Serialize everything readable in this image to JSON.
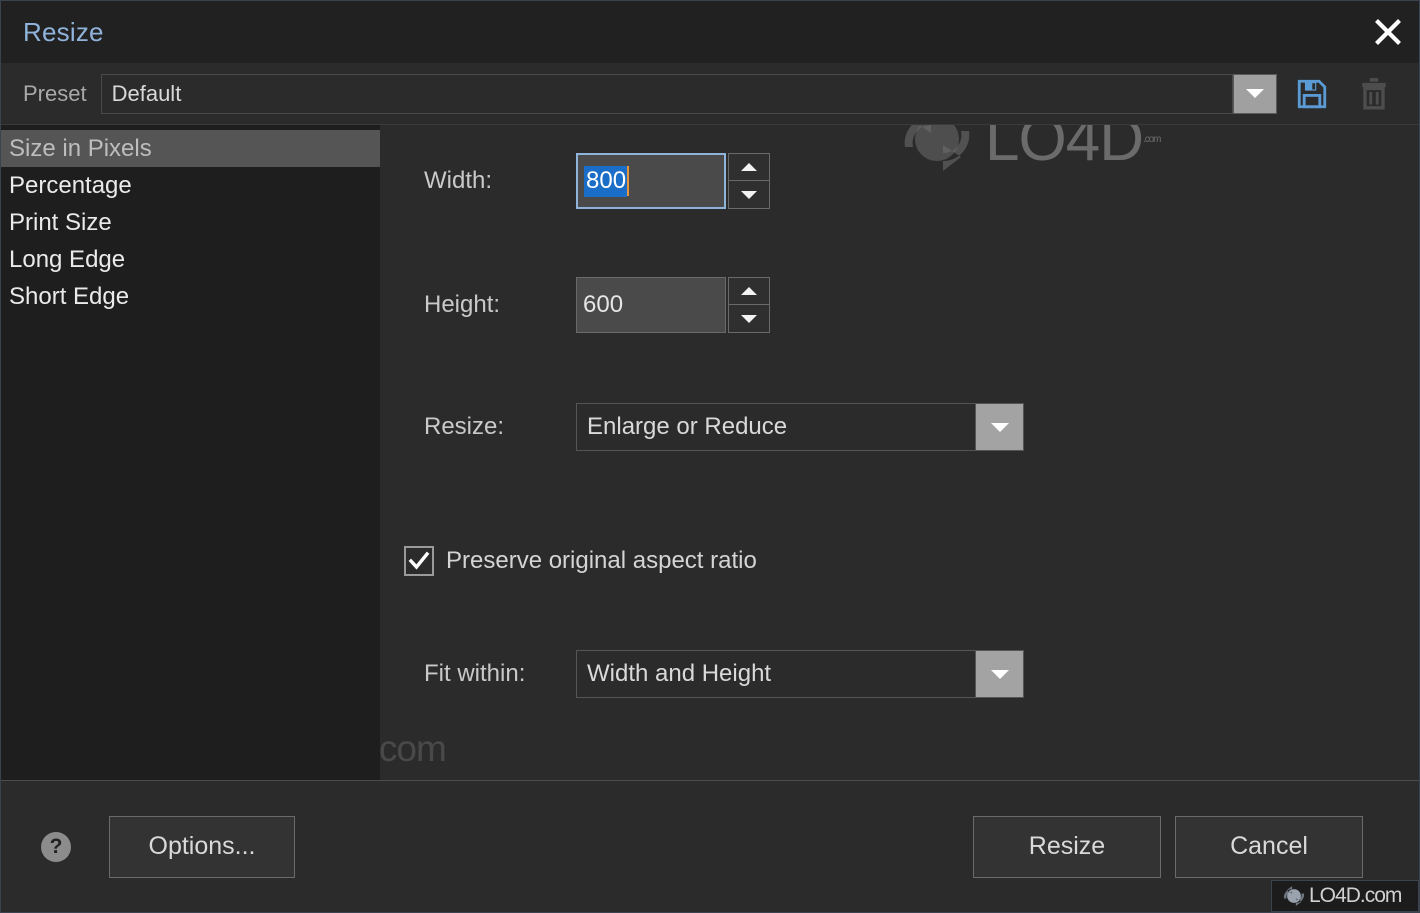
{
  "window": {
    "title": "Resize",
    "close_icon": "close-icon"
  },
  "preset": {
    "label": "Preset",
    "value": "Default",
    "placeholder": "Default",
    "dropdown_icon": "chevron-down-icon",
    "save_icon": "save-floppy-icon",
    "delete_icon": "trash-icon"
  },
  "sidebar": {
    "items": [
      {
        "label": "Size in Pixels",
        "selected": true
      },
      {
        "label": "Percentage",
        "selected": false
      },
      {
        "label": "Print Size",
        "selected": false
      },
      {
        "label": "Long Edge",
        "selected": false
      },
      {
        "label": "Short Edge",
        "selected": false
      }
    ]
  },
  "form": {
    "width": {
      "label": "Width:",
      "value": "800",
      "selected": true,
      "focused": true,
      "spinner_up_icon": "triangle-up-icon",
      "spinner_down_icon": "triangle-down-icon"
    },
    "height": {
      "label": "Height:",
      "value": "600",
      "selected": false,
      "focused": false,
      "spinner_up_icon": "triangle-up-icon",
      "spinner_down_icon": "triangle-down-icon"
    },
    "resize_mode": {
      "label": "Resize:",
      "value": "Enlarge or Reduce",
      "dropdown_icon": "chevron-down-icon"
    },
    "preserve_aspect": {
      "label": "Preserve original aspect ratio",
      "checked": true,
      "check_icon": "checkmark-icon"
    },
    "fit_within": {
      "label": "Fit within:",
      "value": "Width and Height",
      "dropdown_icon": "chevron-down-icon"
    }
  },
  "footer": {
    "help_icon": "help-question-icon",
    "help_glyph": "?",
    "options_label": "Options...",
    "resize_label": "Resize",
    "cancel_label": "Cancel"
  },
  "watermark": {
    "brand": "LO4D",
    "suffix": ".com",
    "logo_icon": "lo4d-refresh-logo-icon"
  },
  "colors": {
    "accent_title": "#8fb3da",
    "selection_blue": "#1a6ec8",
    "caret_orange": "#e8963c",
    "save_icon_blue": "#5b9bd5",
    "window_bg": "#2b2b2b",
    "sidebar_bg": "#1e1e1e",
    "titlebar_bg": "#212121"
  }
}
